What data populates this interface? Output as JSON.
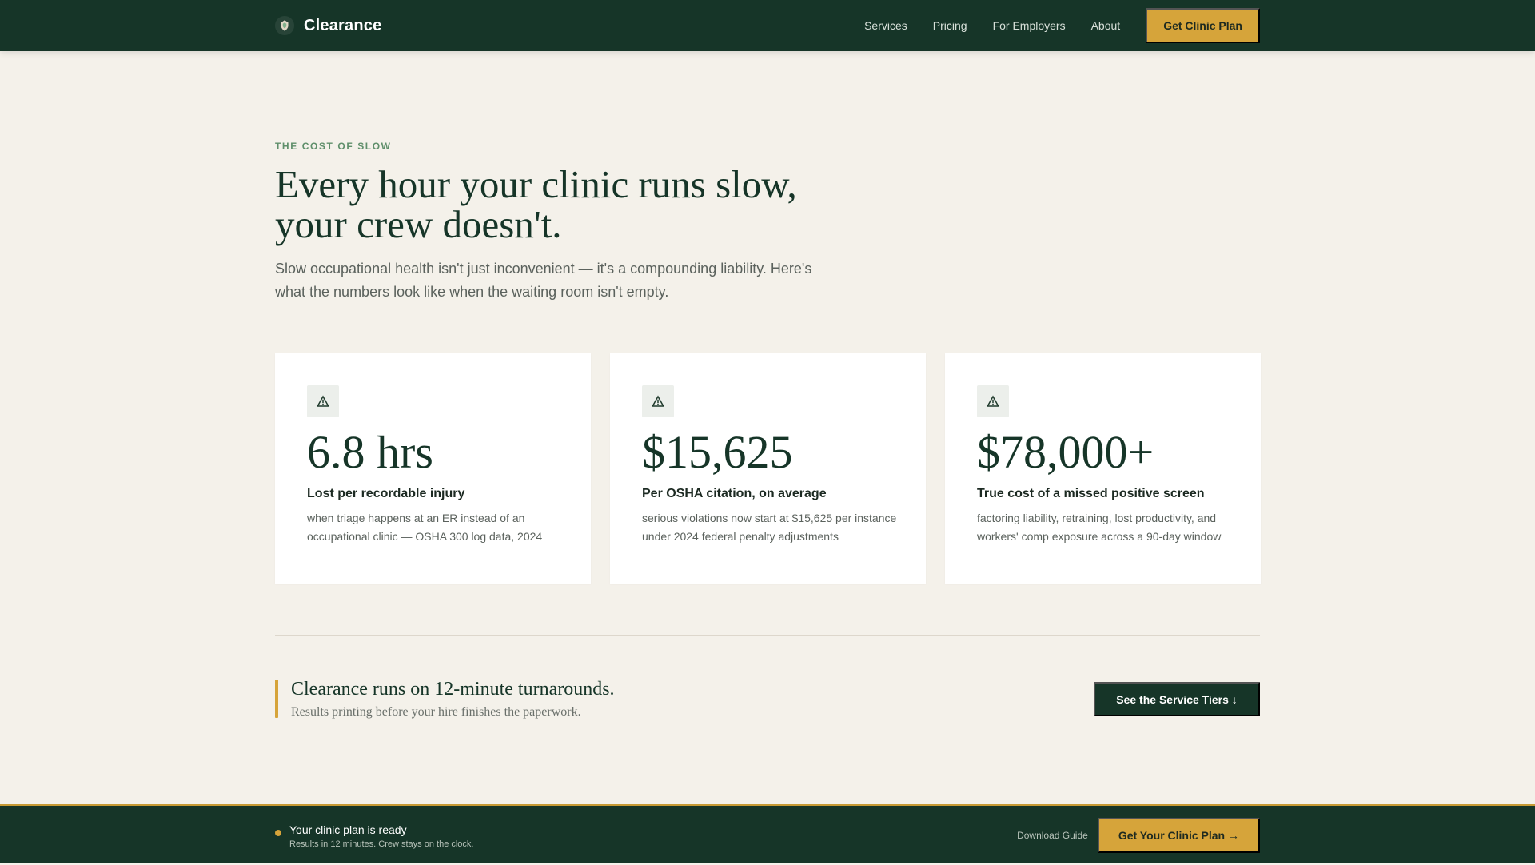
{
  "header": {
    "brand_name": "Clearance",
    "nav_items": [
      "Services",
      "Pricing",
      "For Employers",
      "About"
    ],
    "cta_label": "Get Clinic Plan"
  },
  "hero": {
    "eyebrow": "THE COST OF SLOW",
    "title_line1": "Every hour your clinic runs slow,",
    "title_line2": "your crew doesn't.",
    "lead": "Slow occupational health isn't just inconvenient — it's a compounding liability. Here's what the numbers look like when the waiting room isn't empty."
  },
  "stats": [
    {
      "value": "6.8 hrs",
      "title": "Lost per recordable injury",
      "desc": "when triage happens at an ER instead of an occupational clinic — OSHA 300 log data, 2024",
      "icon": "warning-icon"
    },
    {
      "value": "$15,625",
      "title": "Per OSHA citation, on average",
      "desc": "serious violations now start at $15,625 per instance under 2024 federal penalty adjustments",
      "icon": "warning-icon"
    },
    {
      "value": "$78,000+",
      "title": "True cost of a missed positive screen",
      "desc": "factoring liability, retraining, lost productivity, and workers' comp exposure across a 90-day window",
      "icon": "warning-icon"
    }
  ],
  "callout": {
    "title": "Clearance runs on 12-minute turnarounds.",
    "subtitle": "Results printing before your hire finishes the paperwork.",
    "button_label": "See the Service Tiers ↓"
  },
  "bottom_bar": {
    "status_title": "Your clinic plan is ready",
    "status_subtitle": "Results in 12 minutes. Crew stays on the clock.",
    "download_label": "Download Guide",
    "cta_label": "Get Your Clinic Plan →"
  },
  "colors": {
    "background": "#f4f1ea",
    "primary_dark_green": "#163528",
    "accent_gold": "#d6a43a",
    "eyebrow_green": "#5f8f6b"
  }
}
